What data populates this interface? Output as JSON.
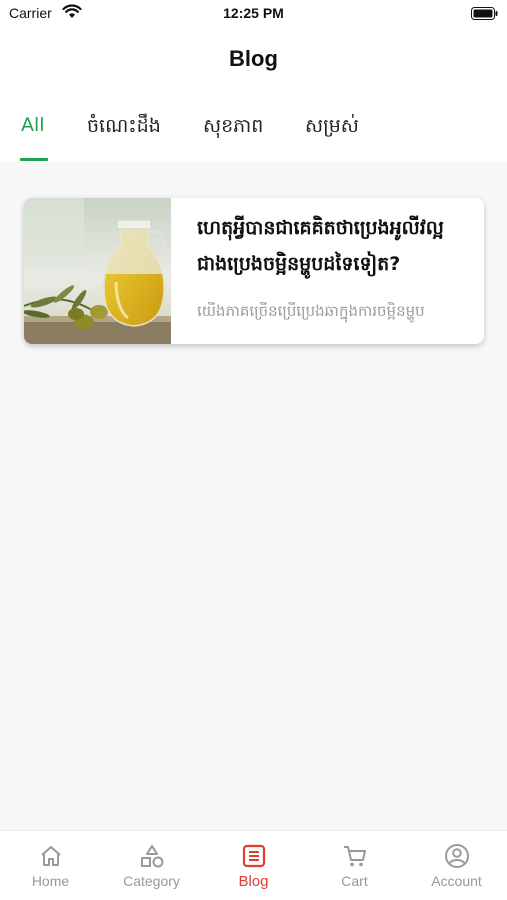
{
  "status_bar": {
    "carrier": "Carrier",
    "time": "12:25 PM"
  },
  "header": {
    "title": "Blog"
  },
  "tabs": [
    {
      "label": "All",
      "active": true
    },
    {
      "label": "ចំណេះដឹង",
      "active": false
    },
    {
      "label": "សុខភាព",
      "active": false
    },
    {
      "label": "សម្រស់",
      "active": false
    }
  ],
  "posts": [
    {
      "title": "ហេតុអ្វីបានជាគេគិតថាប្រេងអូលីវល្អជាងប្រេងចម្អិនម្ហូបដទៃទៀត?",
      "excerpt": "យើងភាគច្រើនប្រើប្រេងឆាក្នុងការចម្អិនម្ហូប",
      "image": "olive-oil-jar-photo"
    }
  ],
  "bottom_nav": [
    {
      "label": "Home",
      "icon": "home-icon",
      "active": false
    },
    {
      "label": "Category",
      "icon": "category-icon",
      "active": false
    },
    {
      "label": "Blog",
      "icon": "blog-icon",
      "active": true
    },
    {
      "label": "Cart",
      "icon": "cart-icon",
      "active": false
    },
    {
      "label": "Account",
      "icon": "account-icon",
      "active": false
    }
  ],
  "colors": {
    "accent_green": "#1fa055",
    "active_nav_red": "#e03c31",
    "inactive_gray": "#999999"
  }
}
